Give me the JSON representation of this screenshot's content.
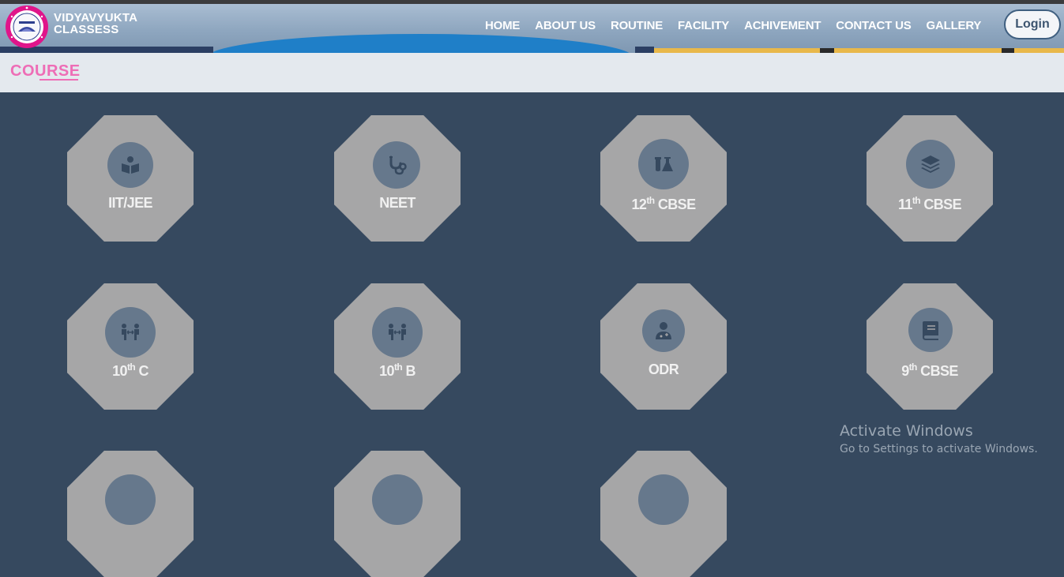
{
  "brand": {
    "line1": "VIDYAVYUKTA",
    "line2": "CLASSESS",
    "logo_icon": "vidyavyukta-classes-logo"
  },
  "nav": {
    "items": [
      {
        "label": "HOME"
      },
      {
        "label": "ABOUT US"
      },
      {
        "label": "ROUTINE"
      },
      {
        "label": "FACILITY"
      },
      {
        "label": "ACHIVEMENT"
      },
      {
        "label": "CONTACT US"
      },
      {
        "label": "GALLERY"
      }
    ],
    "login_label": "Login"
  },
  "section": {
    "title": "COURSE"
  },
  "courses": [
    {
      "label": "IIT/JEE",
      "icon": "book-reader-icon"
    },
    {
      "label": "NEET",
      "icon": "stethoscope-icon"
    },
    {
      "label_main": "12",
      "label_sup": "th",
      "label_rest": " CBSE",
      "icon": "flask-icon"
    },
    {
      "label_main": "11",
      "label_sup": "th",
      "label_rest": " CBSE",
      "icon": "layers-icon"
    },
    {
      "label_main": "10",
      "label_sup": "th",
      "label_rest": " C",
      "icon": "people-arrows-icon"
    },
    {
      "label_main": "10",
      "label_sup": "th",
      "label_rest": " B",
      "icon": "people-arrows-icon"
    },
    {
      "label": "ODR",
      "icon": "user-doctor-icon"
    },
    {
      "label_main": "9",
      "label_sup": "th",
      "label_rest": " CBSE",
      "icon": "book-icon"
    }
  ],
  "watermark": {
    "line1": "Activate Windows",
    "line2": "Go to Settings to activate Windows."
  },
  "colors": {
    "page_bg": "#36495f",
    "tile": "#a6a6a7",
    "accent_pink": "#ee6db6",
    "icon_circle": "#66788c"
  }
}
